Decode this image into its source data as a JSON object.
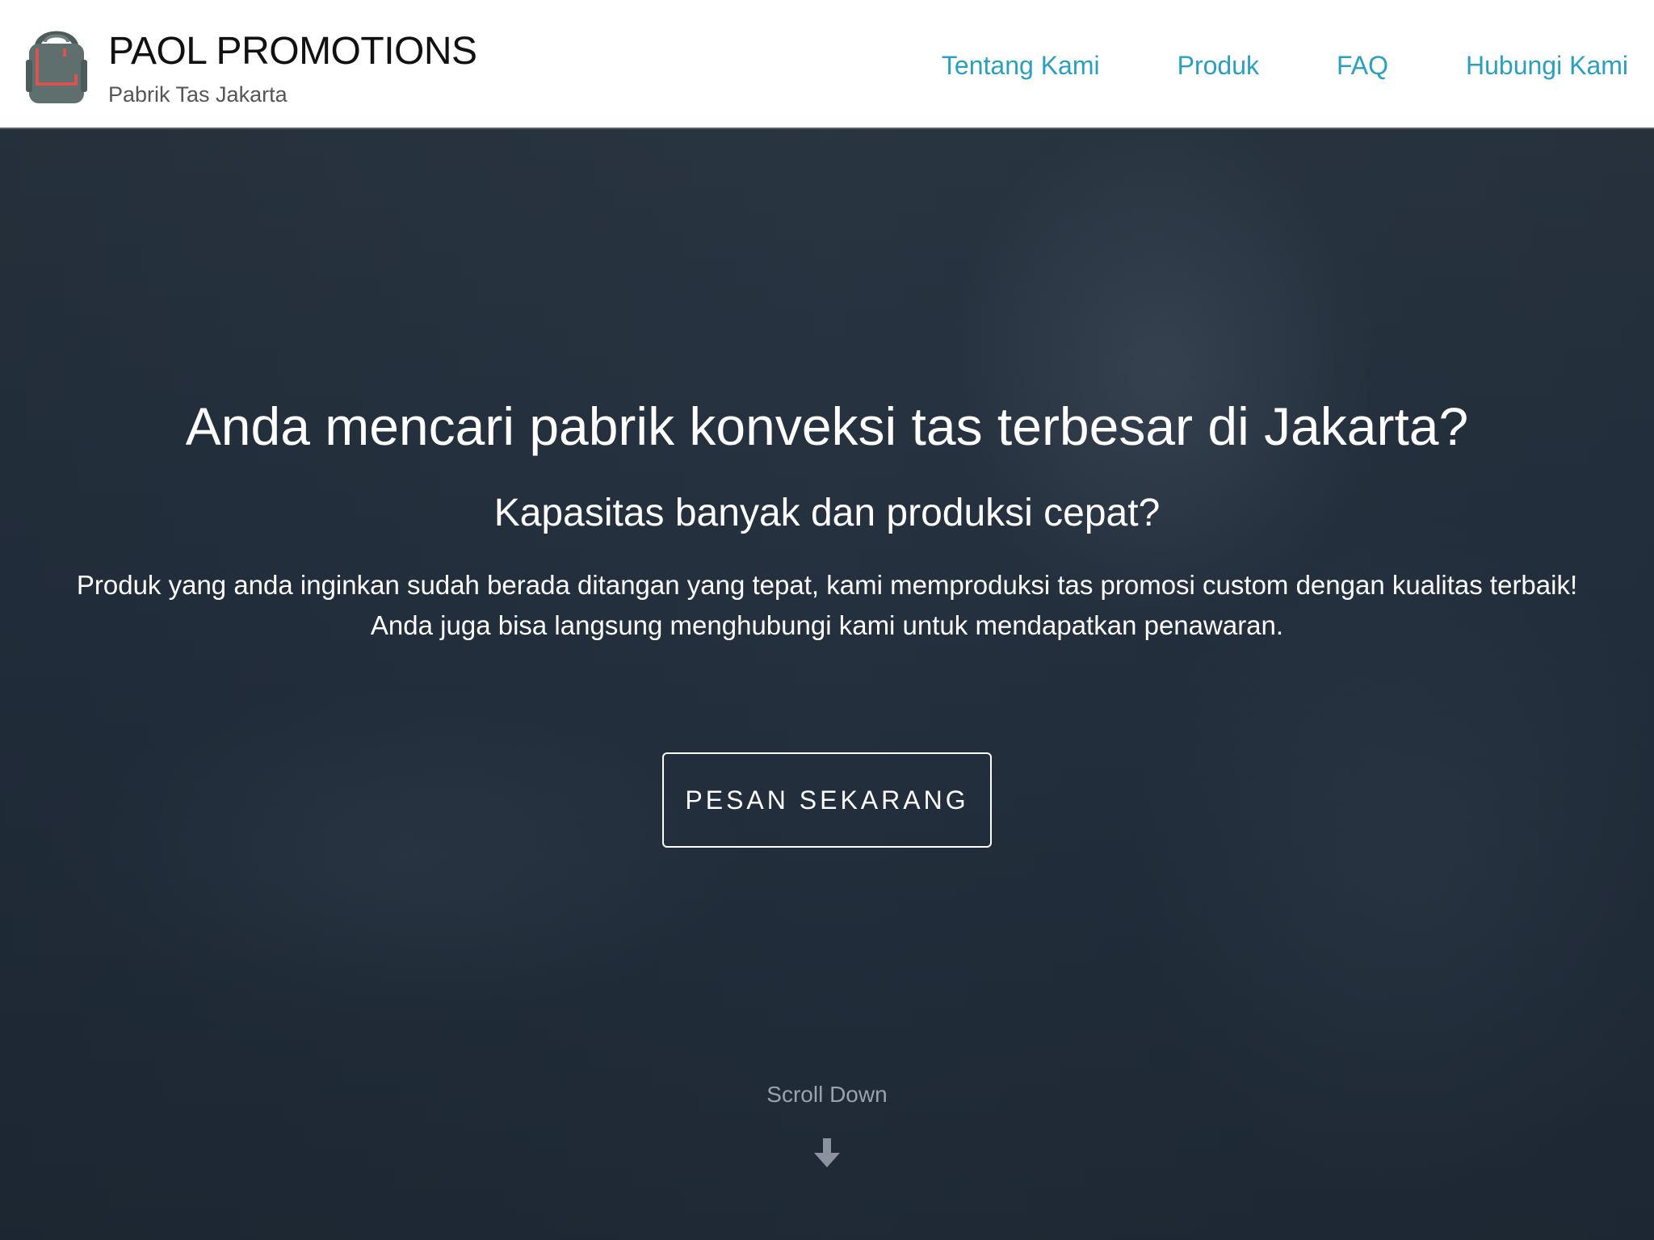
{
  "header": {
    "logo_icon": "backpack-icon",
    "brand_title": "PAOL PROMOTIONS",
    "brand_subtitle": "Pabrik Tas Jakarta",
    "nav": [
      {
        "label": "Tentang Kami"
      },
      {
        "label": "Produk"
      },
      {
        "label": "FAQ"
      },
      {
        "label": "Hubungi Kami"
      }
    ]
  },
  "hero": {
    "headline": "Anda mencari pabrik konveksi tas terbesar di Jakarta?",
    "subheadline": "Kapasitas banyak dan produksi cepat?",
    "intro": "Produk yang anda inginkan sudah berada ditangan yang tepat, kami memproduksi tas promosi custom dengan kualitas terbaik! Anda juga bisa langsung menghubungi kami untuk mendapatkan penawaran.",
    "cta_label": "PESAN SEKARANG",
    "scroll_label": "Scroll Down",
    "scroll_icon": "arrow-down-icon"
  },
  "colors": {
    "nav_link": "#2a9fc0",
    "hero_overlay": "#253140",
    "logo_body": "#5f6f6d",
    "logo_accent": "#d9534f"
  }
}
